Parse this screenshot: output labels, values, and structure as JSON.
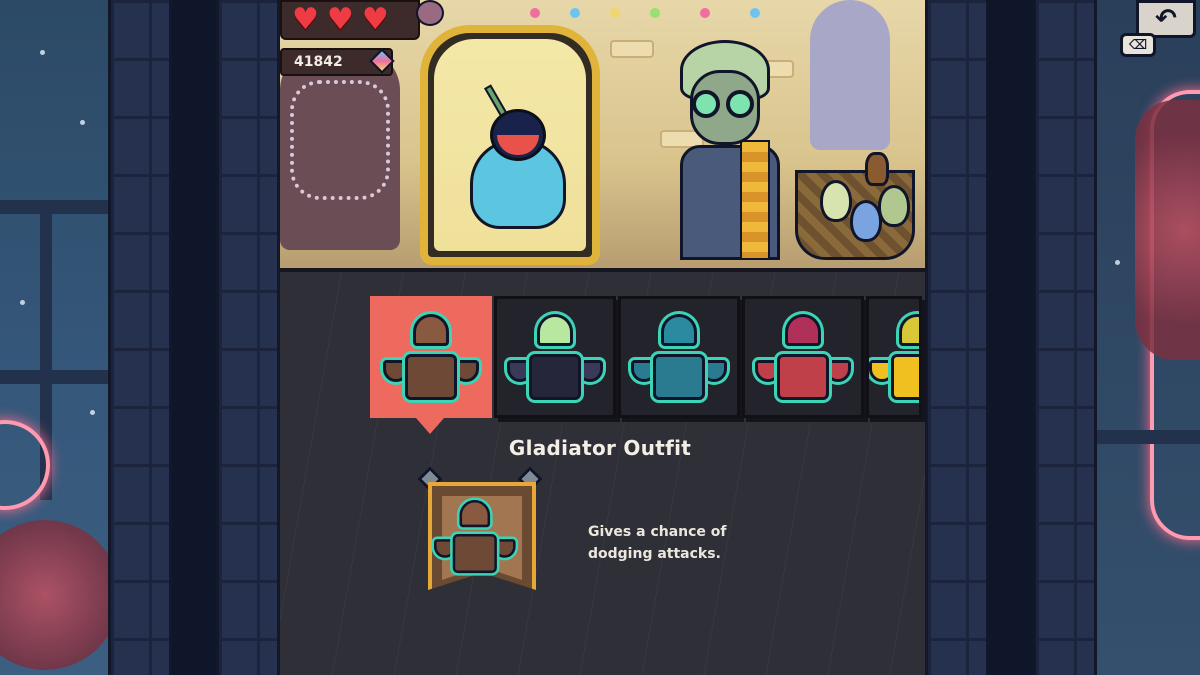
{
  "hud": {
    "hearts": [
      "♥",
      "♥",
      "♥"
    ],
    "gem_count": "41842"
  },
  "controls": {
    "back_glyph": "↶",
    "key_hint_glyph": "⌫"
  },
  "shop": {
    "selected_index": 0,
    "items": [
      {
        "name": "gladiator-outfit",
        "icon": "gladiator-outfit-icon",
        "helm": "#8a5a40",
        "torso": "#6e4a36",
        "shoulder": "#6e4a36"
      },
      {
        "name": "skeleton-outfit",
        "icon": "skeleton-outfit-icon",
        "helm": "#b8e8a0",
        "torso": "#26263a",
        "shoulder": "#3a3a58"
      },
      {
        "name": "knight-outfit",
        "icon": "knight-outfit-icon",
        "helm": "#2a8aa0",
        "torso": "#2a7a90",
        "shoulder": "#2a7a90"
      },
      {
        "name": "royal-outfit",
        "icon": "royal-outfit-icon",
        "helm": "#b0305a",
        "torso": "#c0404a",
        "shoulder": "#c0404a"
      },
      {
        "name": "bee-outfit",
        "icon": "bee-outfit-icon",
        "helm": "#d8c838",
        "torso": "#f0c020",
        "shoulder": "#f0c020"
      }
    ],
    "detail": {
      "title": "Gladiator Outfit",
      "description_line1": "Gives a chance of",
      "description_line2": "dodging attacks."
    }
  },
  "colors": {
    "selected_tile": "#ef6a5e",
    "outline_accent": "#3cd4b4",
    "banner_gold": "#e8a838",
    "heart_red": "#ef3b43"
  }
}
